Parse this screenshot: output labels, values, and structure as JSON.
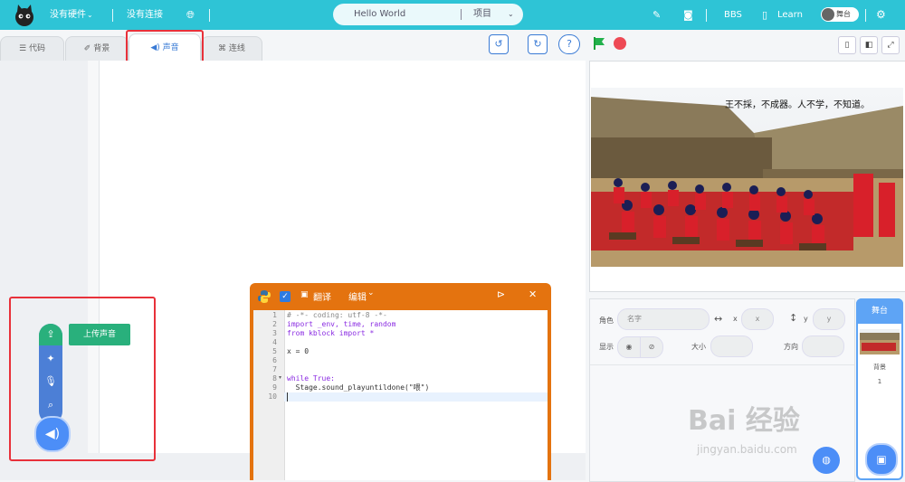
{
  "topbar": {
    "hardware": "没有硬件",
    "connection": "没有连接",
    "project_name": "Hello World",
    "project_menu": "项目",
    "bbs": "BBS",
    "learn": "Learn",
    "stage_toggle": "舞台"
  },
  "tabs": [
    {
      "label": "代码"
    },
    {
      "label": "背景"
    },
    {
      "label": "声音"
    },
    {
      "label": "连线"
    }
  ],
  "sound_menu": {
    "upload_label": "上传声音"
  },
  "stage": {
    "caption": "王不採，不成器。人不学，不知道。"
  },
  "sprite_panel": {
    "sprite_label": "角色",
    "name_placeholder": "名字",
    "x_label": "x",
    "x_placeholder": "x",
    "y_label": "y",
    "y_placeholder": "y",
    "show_label": "显示",
    "size_label": "大小",
    "direction_label": "方向"
  },
  "stage_card": {
    "title": "舞台",
    "backdrop_label": "背景",
    "backdrop_count": "1"
  },
  "code_window": {
    "translate": "翻译",
    "edit": "编辑",
    "line_numbers": [
      "1",
      "2",
      "3",
      "4",
      "5",
      "6",
      "7",
      "8",
      "9",
      "10"
    ],
    "lines": [
      "# -*- coding: utf-8 -*-",
      "import _env, time, random",
      "from kblock import *",
      "",
      "x = 0",
      "",
      "",
      "while True:",
      "  Stage.sound_playuntildone(\"喂\")",
      ""
    ]
  },
  "watermark": {
    "main": "Bai 经验",
    "sub": "jingyan.baidu.com"
  },
  "colors": {
    "topbar": "#2ec4d6",
    "accent": "#3a7bd5",
    "code_window": "#e4730f",
    "upload": "#29b07c"
  }
}
